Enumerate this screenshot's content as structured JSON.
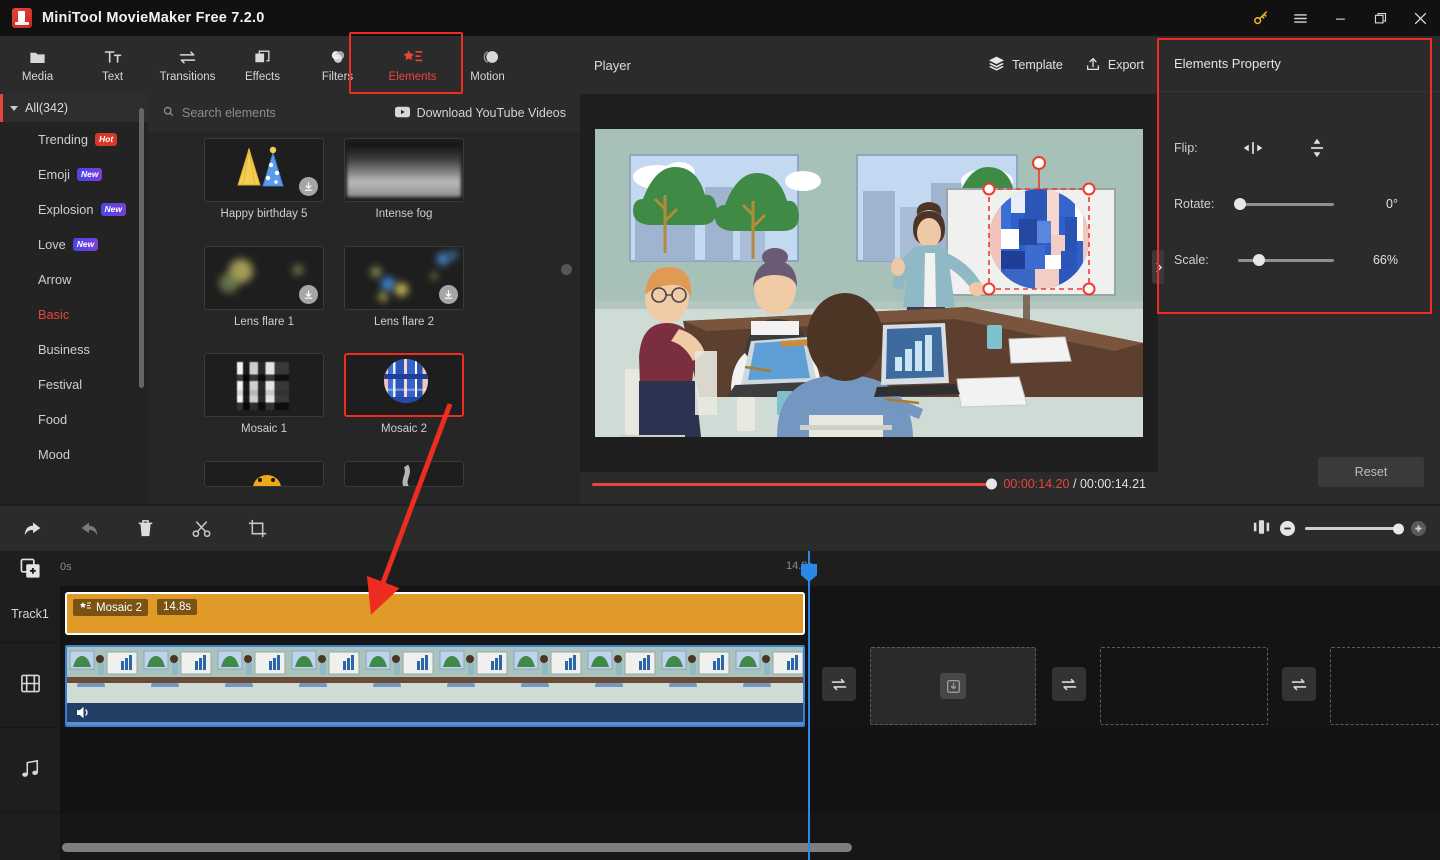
{
  "window": {
    "title": "MiniTool MovieMaker Free 7.2.0",
    "logo_icon": "app-logo-icon",
    "controls": [
      {
        "name": "key-icon",
        "glyph": "key"
      },
      {
        "name": "menu-icon",
        "glyph": "hamburger"
      },
      {
        "name": "minimize-icon",
        "glyph": "minimize"
      },
      {
        "name": "maximize-icon",
        "glyph": "maximize"
      },
      {
        "name": "close-icon",
        "glyph": "close"
      }
    ]
  },
  "toolbar": {
    "items": [
      {
        "label": "Media",
        "icon": "folder-icon",
        "active": false
      },
      {
        "label": "Text",
        "icon": "text-icon",
        "active": false
      },
      {
        "label": "Transitions",
        "icon": "transitions-icon",
        "active": false
      },
      {
        "label": "Effects",
        "icon": "effects-icon",
        "active": false
      },
      {
        "label": "Filters",
        "icon": "filters-icon",
        "active": false
      },
      {
        "label": "Elements",
        "icon": "elements-icon",
        "active": true
      },
      {
        "label": "Motion",
        "icon": "motion-icon",
        "active": false
      }
    ],
    "highlight_color": "#ee2c20"
  },
  "categories": {
    "all_label": "All(342)",
    "items": [
      {
        "label": "Trending",
        "badge": "Hot",
        "badge_type": "hot"
      },
      {
        "label": "Emoji",
        "badge": "New",
        "badge_type": "new"
      },
      {
        "label": "Explosion",
        "badge": "New",
        "badge_type": "new"
      },
      {
        "label": "Love",
        "badge": "New",
        "badge_type": "new"
      },
      {
        "label": "Arrow",
        "badge": "",
        "badge_type": ""
      },
      {
        "label": "Basic",
        "badge": "",
        "badge_type": "",
        "selected": true
      },
      {
        "label": "Business",
        "badge": "",
        "badge_type": ""
      },
      {
        "label": "Festival",
        "badge": "",
        "badge_type": ""
      },
      {
        "label": "Food",
        "badge": "",
        "badge_type": ""
      },
      {
        "label": "Mood",
        "badge": "",
        "badge_type": ""
      }
    ]
  },
  "elements_browser": {
    "search_placeholder": "Search elements",
    "search_icon": "search-icon",
    "download_label": "Download YouTube Videos",
    "download_icon": "youtube-download-icon",
    "items": [
      {
        "label": "Happy birthday 5",
        "art": "party",
        "downloadable": true,
        "selected": false
      },
      {
        "label": "Intense fog",
        "art": "fog",
        "downloadable": false,
        "selected": false
      },
      {
        "label": "Lens flare 1",
        "art": "flare1",
        "downloadable": true,
        "selected": false
      },
      {
        "label": "Lens flare 2",
        "art": "flare2",
        "downloadable": true,
        "selected": false
      },
      {
        "label": "Mosaic 1",
        "art": "mosaic1",
        "downloadable": false,
        "selected": false
      },
      {
        "label": "Mosaic 2",
        "art": "mosaic2",
        "downloadable": false,
        "selected": true
      }
    ]
  },
  "player": {
    "label": "Player",
    "template_label": "Template",
    "template_icon": "layers-icon",
    "export_label": "Export",
    "export_icon": "upload-icon",
    "current_time": "00:00:14.20",
    "separator": "/",
    "total_time": "00:00:14.21",
    "progress_percent": 99,
    "volume_percent": 100,
    "aspect_ratio": "16:9",
    "controls": [
      {
        "name": "play-button",
        "icon": "play-icon"
      },
      {
        "name": "previous-frame-button",
        "icon": "skip-back-icon"
      },
      {
        "name": "next-frame-button",
        "icon": "skip-forward-icon"
      },
      {
        "name": "stop-button",
        "icon": "stop-icon"
      },
      {
        "name": "volume-button",
        "icon": "volume-icon"
      }
    ],
    "fullscreen_icon": "fullscreen-icon"
  },
  "properties": {
    "title": "Elements Property",
    "flip_label": "Flip:",
    "flip_horizontal_icon": "flip-horizontal-icon",
    "flip_vertical_icon": "flip-vertical-icon",
    "rotate_label": "Rotate:",
    "rotate_value": "0°",
    "rotate_percent": 0,
    "scale_label": "Scale:",
    "scale_value": "66%",
    "scale_percent": 22,
    "reset_label": "Reset",
    "collapse_icon": "chevron-right-icon",
    "highlight_color": "#ee2c20"
  },
  "timeline": {
    "tools": [
      {
        "name": "undo-button",
        "icon": "undo-icon",
        "enabled": true
      },
      {
        "name": "redo-button",
        "icon": "redo-icon",
        "enabled": false
      },
      {
        "name": "delete-button",
        "icon": "trash-icon",
        "enabled": true
      },
      {
        "name": "split-button",
        "icon": "scissors-icon",
        "enabled": true
      },
      {
        "name": "crop-button",
        "icon": "crop-icon",
        "enabled": true
      }
    ],
    "fit_icon": "fit-timeline-icon",
    "zoom_out_icon": "zoom-out-icon",
    "zoom_in_icon": "zoom-in-icon",
    "zoom_percent": 100,
    "add_track_icon": "add-track-icon",
    "ruler_start": "0s",
    "ruler_mark": "14.8s",
    "track_headers": [
      {
        "label": "Track1",
        "icon": ""
      },
      {
        "label": "",
        "icon": "video-track-icon"
      },
      {
        "label": "",
        "icon": "music-track-icon"
      }
    ],
    "element_clip": {
      "icon": "elements-icon",
      "name": "Mosaic 2",
      "duration": "14.8s",
      "color": "#e09a28"
    },
    "video_clip": {
      "audio_icon": "speaker-icon",
      "border_color": "#3f7fd0"
    },
    "transition_slots": [
      {
        "icon": "transition-swap-icon"
      },
      {
        "icon": "transition-swap-icon"
      },
      {
        "icon": "transition-swap-icon"
      }
    ],
    "placeholder_icon": "download-box-icon",
    "playhead_color": "#2b88e8"
  },
  "annotation": {
    "arrow_color": "#ee2c20",
    "from": "Mosaic 2 element thumbnail",
    "to": "Track1 timeline clip"
  }
}
